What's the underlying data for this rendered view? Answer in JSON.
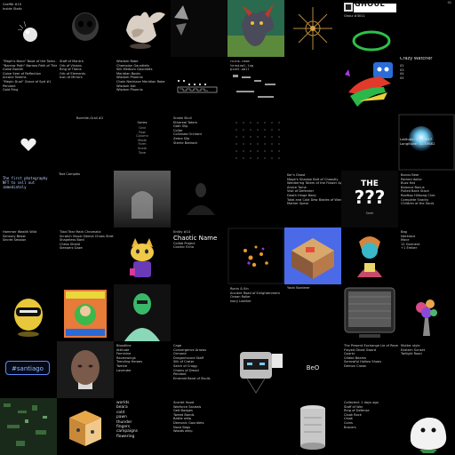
{
  "tiles": {
    "r0c0": {
      "title": "Graffiti #10",
      "subtitle": "Inside Static"
    },
    "r0c6": {
      "banner": "GHOUL",
      "text_lines": [
        "Ghoul #3011",
        "HP",
        "Rank"
      ]
    },
    "r0c7": {
      "title": "Crazy Watcher",
      "items": [
        "01",
        "02",
        "03",
        "04",
        "05",
        "06",
        "07",
        "08",
        "09",
        "10",
        "11",
        "12",
        "13"
      ]
    },
    "r1c0": {
      "lines": [
        "\"Moph's Neon\" Book of the Twins #1",
        "\"Narrow Path\" Narrow Path of Thieve #1",
        "Guise Bandit",
        "Guise Seer of Reflection",
        "Arcane Totems",
        "\"Mepin Dual\" Grove of Spit #1",
        "Pendant",
        "Gold Ring"
      ]
    },
    "r1c1": {
      "lines": [
        "Staff of Mantra",
        "Orb of Visions",
        "Ring of Titans",
        "Orb of Elements",
        "Icon of Mirrors"
      ]
    },
    "r1c2": {
      "lines": [
        "Wisdom Robe",
        "Champion Gauntlets",
        "Silk Medium Gauntlets",
        "Meridian Boots",
        "Wisdom Phoenix",
        "Chain Necklace Meridian Robe",
        "Wisdom Hat",
        "Wisdom Phoenix"
      ]
    },
    "r1c4": {
      "lines": [
        "ruins-room",
        "terminal-log",
        "pixel-wall"
      ]
    },
    "r2c0": {
      "icon": "heart"
    },
    "r2c1": {
      "label": "Borrelle-Grail #2"
    },
    "r2c2": {
      "label": "Series",
      "lines": [
        "Grid",
        "Row",
        "Column",
        "Mode",
        "Form",
        "Scale",
        "Tone"
      ]
    },
    "r2c3": {
      "lines": [
        "Snake Skull",
        "Ethereal Totem",
        "Goth Slip",
        "Collar",
        "Collinsea Orchard",
        "Zebra Slip",
        "Sterile Bedrock"
      ]
    },
    "r2c7": {
      "latitude": "Latitude: 77.14957",
      "longitude": "Longitude: 11.53682"
    },
    "r3c0": {
      "text": "The first photography NFT to sell out immediately"
    },
    "r3c1": {
      "text": "Text Complex"
    },
    "r3c5": {
      "lines": [
        "Ker's Ghost",
        "Mage's Shadow Bolt of Chaostly",
        "Wandering Totem of the Flower Apart",
        "Amice Tome",
        "Visit of Defender",
        "Death Hinge Body",
        "Total and Cold Dew Blades of Wanderlust",
        "Mother Spear"
      ]
    },
    "r3c6": {
      "headline": "THE",
      "marks": "???",
      "caption": "Seek"
    },
    "r3c7": {
      "lines": [
        "Bonus Bear",
        "Packed dollar",
        "Buzz Hat",
        "Balance Bonus",
        "Pulled Back Stack",
        "Rooftop Hillsong Club",
        "Complete Snacky",
        "Children of the Souls"
      ]
    },
    "r4c0": {
      "lines": [
        "Hammer Wealth Wild",
        "Sensory Beast",
        "Secret Session"
      ]
    },
    "r4c1": {
      "lines": [
        "Tidal Tear Mark Chromatic",
        "Scratch Visual Sleeve Chaos Stretch",
        "Shapeless Bard",
        "Chess Shield",
        "Sleepers Gaze"
      ]
    },
    "r4c3": {
      "lines": [
        "Entity #10",
        "Chaotic Name",
        "Collab Project",
        "Cosmic Echo"
      ]
    },
    "r4c7": {
      "lines": [
        "Bag",
        "Necklace",
        "Mace",
        "12 Garment",
        "+1 Ember"
      ]
    },
    "r5c4": {
      "lines": [
        "Ronin & Kin",
        "Ancient Road of Enlightenment",
        "Ocean Roller",
        "Ivory Leather",
        "Ink Wagoner",
        "Oracle Summoner",
        "Pendant of Detection",
        "Platinum Ring"
      ]
    },
    "r5c5": {
      "lines": [
        "Yoshi Borderer"
      ]
    },
    "r6c0": {
      "handle": "#santiago"
    },
    "r6c2": {
      "lines": [
        "Bloodline",
        "Attitude",
        "Feminine",
        "Ravenwings",
        "Trending Heroes",
        "Twelve",
        "Lavender"
      ]
    },
    "r6c3": {
      "lines": [
        "Cage",
        "Convergence Arrows",
        "Ormond",
        "Dragonhound Staff",
        "Silk of Crater",
        "Satch of Cragg",
        "Chains of Dread",
        "Pendant",
        "Emerald Band of Skulls"
      ]
    },
    "r6c5": {
      "text": "BeO"
    },
    "r6c6": {
      "lines": [
        "The Present Exchange Lie of Reversion",
        "Frayed Ghost Sword",
        "Quartz",
        "Gilded Beams",
        "Sorrowful Hollow Shoes",
        "Demon Crown"
      ]
    },
    "r6c7": {
      "lines": [
        "Mutter style",
        "Eastern Sunset",
        "Twilight Road"
      ]
    },
    "r7c2": {
      "lines": [
        "worlds",
        "beara",
        "cold",
        "pawn",
        "thunder",
        "fingers",
        "campaigns",
        "flowering"
      ]
    },
    "r7c3": {
      "lines": [
        "Scarlet Hood",
        "Warforce Sandals",
        "Gelt Badges",
        "Tweed Bands",
        "Battle whip",
        "Demonic Gauntlets",
        "Nova Bags",
        "Woods whip"
      ]
    },
    "r7c6": {
      "lines": [
        "Collected: 1 days ago",
        "Staff of War",
        "Ring of Defense",
        "Cloak Rack",
        "Cloak",
        "Coins",
        "Bracers"
      ]
    }
  }
}
